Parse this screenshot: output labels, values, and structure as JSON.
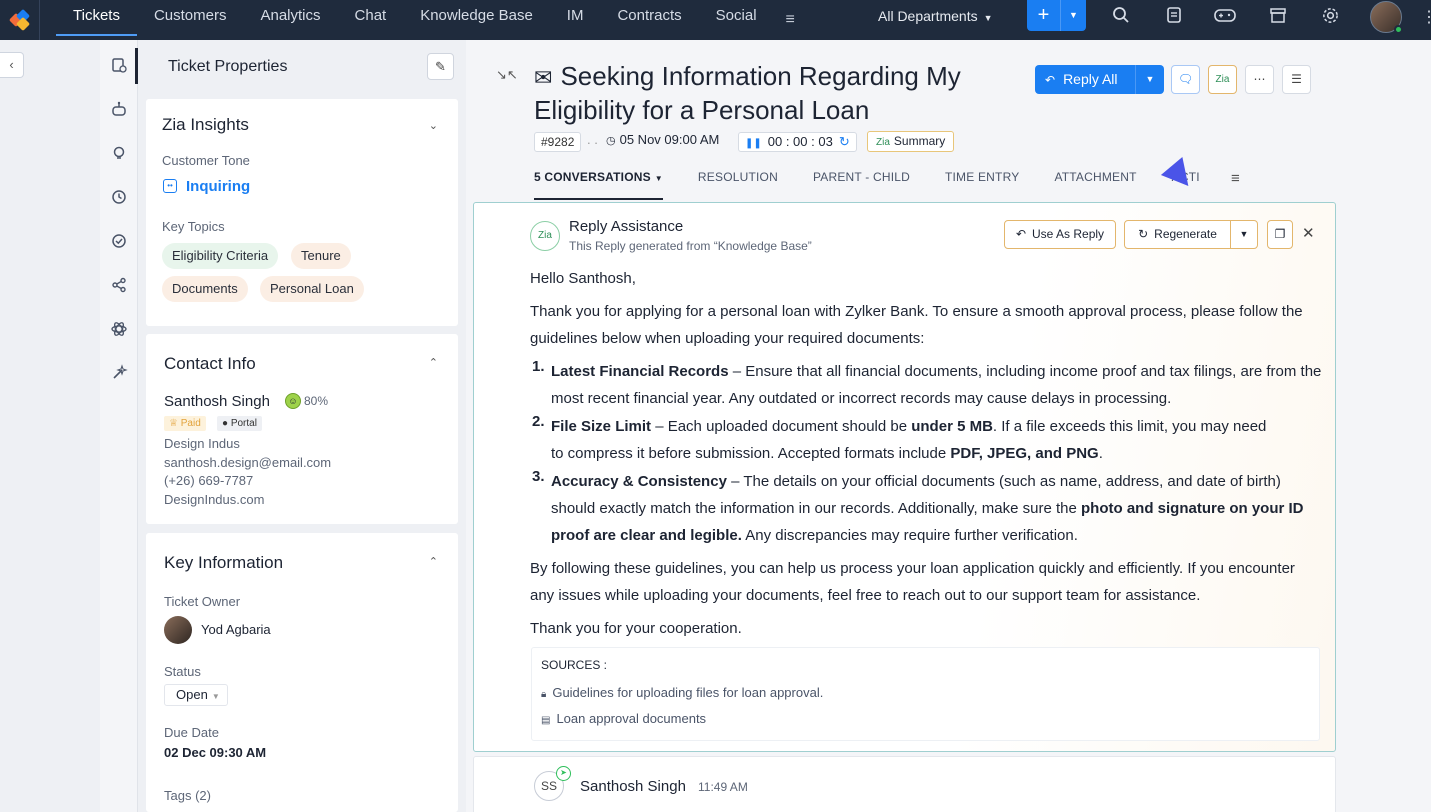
{
  "topnav": {
    "tabs": [
      "Tickets",
      "Customers",
      "Analytics",
      "Chat",
      "Knowledge Base",
      "IM",
      "Contracts",
      "Social"
    ],
    "more_icon": "menu-lines-icon",
    "department": "All Departments",
    "add_icon": "plus-icon",
    "icons": [
      "search-icon",
      "notes-icon",
      "gamepad-icon",
      "store-icon",
      "gear-icon"
    ]
  },
  "props": {
    "title": "Ticket Properties",
    "zia": {
      "title": "Zia Insights",
      "tone_label": "Customer Tone",
      "tone_value": "Inquiring",
      "topics_label": "Key Topics",
      "topics": [
        "Eligibility Criteria",
        "Tenure",
        "Documents",
        "Personal Loan"
      ]
    },
    "contact": {
      "title": "Contact Info",
      "name": "Santhosh Singh",
      "score": "80%",
      "badge_paid": "Paid",
      "badge_portal": "Portal",
      "company": "Design Indus",
      "email": "santhosh.design@email.com",
      "phone": "(+26) 669-7787",
      "website": "DesignIndus.com"
    },
    "key": {
      "title": "Key Information",
      "owner_label": "Ticket Owner",
      "owner": "Yod Agbaria",
      "status_label": "Status",
      "status": "Open",
      "due_label": "Due Date",
      "due": "02 Dec 09:30 AM",
      "tags_label": "Tags (2)"
    }
  },
  "ticket": {
    "subject": "Seeking Information Regarding My Eligibility for a Personal Loan",
    "number": "#9282",
    "dots": ". .",
    "date": "05 Nov 09:00 AM",
    "timer": "00 : 00 : 03",
    "summary": "Summary",
    "reply_all": "Reply All",
    "tabs": [
      "5 CONVERSATIONS",
      "RESOLUTION",
      "PARENT - CHILD",
      "TIME ENTRY",
      "ATTACHMENT",
      "ACTI"
    ]
  },
  "assist": {
    "title": "Reply Assistance",
    "subtitle": "This Reply generated from “Knowledge Base”",
    "use_as_reply": "Use As Reply",
    "regenerate": "Regenerate",
    "greeting": "Hello Santhosh,",
    "intro": "Thank you for applying for a personal loan with Zylker Bank. To ensure a smooth approval process, please follow the guidelines below when uploading your required documents:",
    "items": [
      {
        "num": "1.",
        "head": "Latest Financial Records",
        "text1": " – Ensure that all financial documents, including income proof and tax filings, are from the most recent financial year. Any outdated or incorrect records may cause delays in processing."
      },
      {
        "num": "2.",
        "head": "File Size Limit",
        "text1": " – Each uploaded document should be ",
        "bold1": "under 5 MB",
        "text2": ". If a file exceeds this limit, you may need to compress it before submission. Accepted formats include ",
        "bold2": "PDF, JPEG, and PNG",
        "text3": "."
      },
      {
        "num": "3.",
        "head": "Accuracy & Consistency",
        "text1": " – The details on your official documents (such as name, address, and date of birth) should exactly match the information in our records. Additionally, make sure the ",
        "bold1": "photo and signature on your ID proof are clear and legible.",
        "text2": " Any discrepancies may require further verification."
      }
    ],
    "closing": "By following these guidelines, you can help us process your loan application quickly and efficiently. If you encounter any issues while uploading your documents, feel free to reach out to our support team for assistance.",
    "thanks": "Thank you for your cooperation.",
    "sources_title": "SOURCES :",
    "sources": [
      "Guidelines for uploading files for loan approval.",
      "Loan approval documents"
    ]
  },
  "thread": {
    "initials": "SS",
    "name": "Santhosh Singh",
    "time": "11:49 AM"
  },
  "colors": {
    "topbar": "#1f2b3d",
    "accent": "#1a7ef2",
    "tone": "#1a7ef2"
  }
}
